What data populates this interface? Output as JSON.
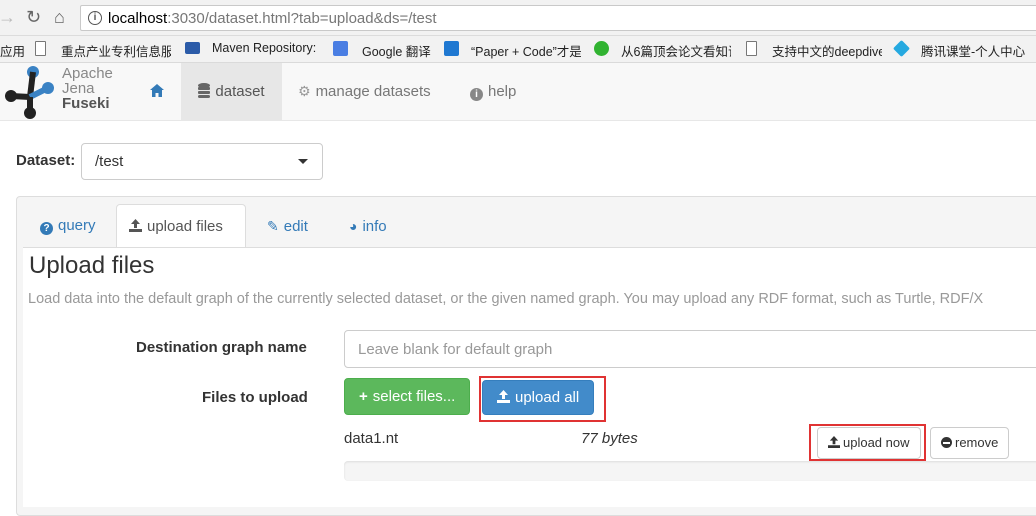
{
  "browser": {
    "url_host": "localhost",
    "url_rest": ":3030/dataset.html?tab=upload&ds=/test",
    "bookmarks": [
      {
        "label": "应用"
      },
      {
        "label": "重点产业专利信息服"
      },
      {
        "label": "Maven Repository:"
      },
      {
        "label": "Google 翻译"
      },
      {
        "label": "“Paper + Code”才是"
      },
      {
        "label": "从6篇顶会论文看知识"
      },
      {
        "label": "支持中文的deepdive"
      },
      {
        "label": "腾讯课堂-个人中心"
      }
    ]
  },
  "logo": {
    "line1": "Apache",
    "line2": "Jena",
    "line3": "Fuseki"
  },
  "navbar": {
    "home_label": "",
    "dataset_label": "dataset",
    "manage_label": "manage datasets",
    "help_label": "help"
  },
  "dataset_picker": {
    "label": "Dataset:",
    "selected": "/test"
  },
  "tabs": {
    "query": "query",
    "upload": "upload files",
    "edit": "edit",
    "info": "info"
  },
  "upload": {
    "title": "Upload files",
    "description": "Load data into the default graph of the currently selected dataset, or the given named graph. You may upload any RDF format, such as Turtle, RDF/X",
    "graph_label": "Destination graph name",
    "graph_placeholder": "Leave blank for default graph",
    "files_label": "Files to upload",
    "select_button": "select files...",
    "upload_all_button": "upload all",
    "file": {
      "name": "data1.nt",
      "size": "77 bytes",
      "progress": 0
    },
    "upload_now_button": "upload now",
    "remove_button": "remove"
  },
  "colors": {
    "brand_blue": "#337ab7",
    "success_green": "#5cb85c",
    "primary_blue": "#428bca",
    "highlight_red": "#e03333"
  }
}
